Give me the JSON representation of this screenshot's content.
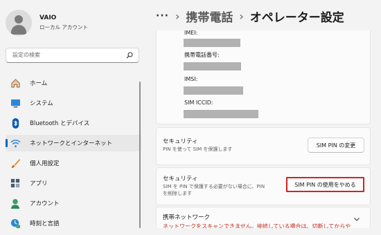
{
  "account": {
    "name": "VAIO",
    "type": "ローカル アカウント"
  },
  "search": {
    "placeholder": "設定の検索"
  },
  "nav": {
    "items": [
      {
        "label": "ホーム",
        "icon": "home-icon"
      },
      {
        "label": "システム",
        "icon": "system-icon"
      },
      {
        "label": "Bluetooth とデバイス",
        "icon": "bluetooth-icon"
      },
      {
        "label": "ネットワークとインターネット",
        "icon": "network-icon",
        "selected": true
      },
      {
        "label": "個人用設定",
        "icon": "brush-icon"
      },
      {
        "label": "アプリ",
        "icon": "apps-icon"
      },
      {
        "label": "アカウント",
        "icon": "account-icon"
      },
      {
        "label": "時刻と言語",
        "icon": "time-language-icon"
      }
    ]
  },
  "breadcrumb": {
    "more": "···",
    "parent": "携帯電話",
    "current": "オペレーター設定"
  },
  "info": {
    "imei_label": "IMEI:",
    "phone_label": "携帯電話番号:",
    "imsi_label": "IMSI:",
    "iccid_label": "SIM ICCID:"
  },
  "security1": {
    "title": "セキュリティ",
    "desc": "PIN を使って SIM を保護します",
    "button": "SIM PIN の変更"
  },
  "security2": {
    "title": "セキュリティ",
    "desc_line1": "SIM を PIN で保護する必要がない場合に、PIN",
    "desc_line2": "を削除します",
    "button": "SIM PIN の使用をやめる"
  },
  "network": {
    "title": "携帯ネットワーク",
    "warning": "ネットワークをスキャンできません。接続している場合は、切断してからや"
  },
  "colors": {
    "accent": "#0067c0",
    "highlight": "#d62020",
    "warning": "#c42b1c"
  }
}
